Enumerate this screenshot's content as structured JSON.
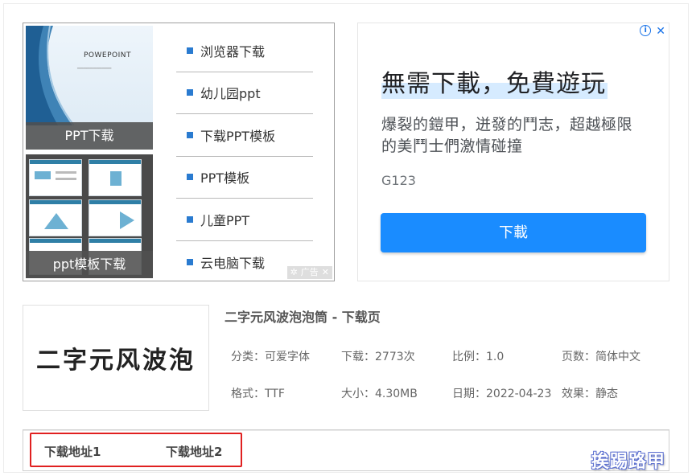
{
  "left_ad": {
    "thumb1": {
      "slide_title": "POWEPOINT",
      "caption": "PPT下载"
    },
    "thumb2": {
      "caption": "ppt模板下载"
    },
    "links": [
      "浏览器下载",
      "幼儿园ppt",
      "下载PPT模板",
      "PPT模板",
      "儿童PPT",
      "云电脑下载"
    ],
    "ad_label": "广告",
    "close_glyph": "✕",
    "icon_colors": {
      "bullet": "#2a7bd0"
    }
  },
  "right_ad": {
    "info_glyph": "i",
    "close_glyph": "✕",
    "headline": "無需下載，免費遊玩",
    "body": "爆裂的鎧甲，迸發的鬥志，超越極限的美鬥士們激情碰撞",
    "domain": "G123",
    "cta": "下載",
    "colors": {
      "cta": "#1a8cff",
      "accent": "#1a73e8"
    }
  },
  "font_info": {
    "preview_text": "二字元风波泡",
    "title": "二字元风波泡泡筒 - 下载页",
    "meta": [
      "分类：可爱字体",
      "下载：2773次",
      "比例：1.0",
      "页数：简体中文",
      "格式：TTF",
      "大小：4.30MB",
      "日期：2022-04-23",
      "效果：静态"
    ]
  },
  "download": {
    "links": [
      "下载地址1",
      "下载地址2"
    ],
    "highlight_color": "#e02020"
  },
  "watermark": "挨踢路甲"
}
